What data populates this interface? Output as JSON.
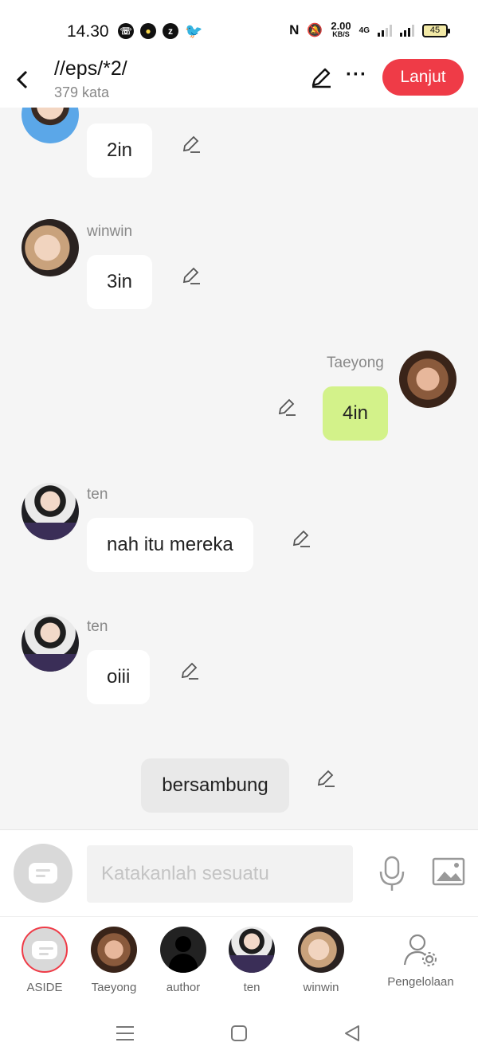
{
  "status_bar": {
    "time": "14.30",
    "net_speed": "2.00",
    "net_unit": "KB/S",
    "network_type": "4G",
    "battery": "45"
  },
  "header": {
    "title": "//eps/*2/",
    "word_count": "379 kata",
    "next_label": "Lanjut"
  },
  "messages": [
    {
      "speaker": "",
      "text": "2in",
      "side": "left"
    },
    {
      "speaker": "winwin",
      "text": "3in",
      "side": "left"
    },
    {
      "speaker": "Taeyong",
      "text": "4in",
      "side": "right"
    },
    {
      "speaker": "ten",
      "text": "nah itu mereka",
      "side": "left"
    },
    {
      "speaker": "ten",
      "text": "oiii",
      "side": "left"
    },
    {
      "speaker": "",
      "text": "bersambung",
      "side": "aside"
    }
  ],
  "composer": {
    "placeholder": "Katakanlah sesuatu"
  },
  "characters": [
    {
      "label": "ASIDE",
      "active": true
    },
    {
      "label": "Taeyong"
    },
    {
      "label": "author"
    },
    {
      "label": "ten"
    },
    {
      "label": "winwin"
    },
    {
      "label": "Pengelolaan"
    }
  ],
  "colors": {
    "accent": "#ef3b47",
    "own_bubble": "#d3f28a",
    "background": "#f5f5f5"
  }
}
